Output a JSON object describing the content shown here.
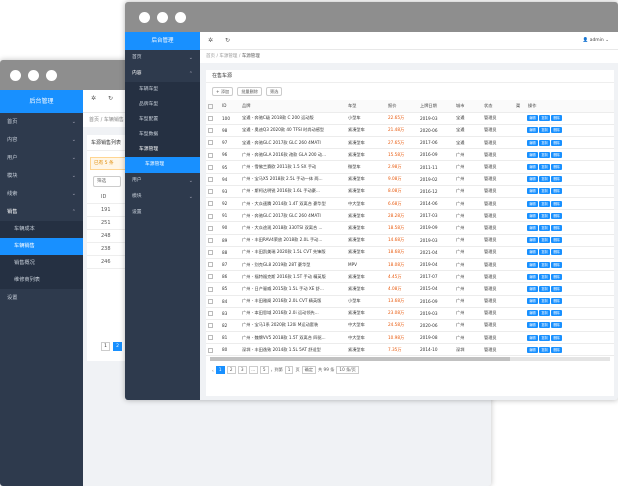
{
  "back": {
    "logo": "后台管理",
    "menu": [
      {
        "label": "首页",
        "chev": "⌄"
      },
      {
        "label": "内容",
        "chev": "⌄"
      },
      {
        "label": "用户",
        "chev": "⌄"
      },
      {
        "label": "模块",
        "chev": "⌄"
      },
      {
        "label": "线索",
        "chev": "⌄"
      },
      {
        "label": "销售",
        "chev": "⌃"
      }
    ],
    "submenu": [
      "车辆成本",
      "车辆销售",
      "销售概况",
      "维修商列表"
    ],
    "settings": "设置",
    "crumb": "首页  /  车辆销售",
    "panel_title": "车源销售列表",
    "warn": "已有 5 条",
    "filter_btn": "筛选",
    "id_header": "ID",
    "ids": [
      "191",
      "251",
      "248",
      "238",
      "246"
    ],
    "pages": [
      "1",
      "2"
    ]
  },
  "front": {
    "logo": "后台管理",
    "menu_top": [
      {
        "label": "首页",
        "chev": "⌄"
      },
      {
        "label": "内容",
        "chev": "⌃"
      }
    ],
    "submenu": [
      "车辆车型",
      "品牌车型",
      "车型配置",
      "车型数据",
      "车源管理"
    ],
    "active_sub": "车源管理",
    "menu_bottom": [
      {
        "label": "用户",
        "chev": "⌄"
      },
      {
        "label": "模块",
        "chev": "⌄"
      },
      {
        "label": "设置",
        "chev": ""
      }
    ],
    "user": "admin",
    "crumb": {
      "home": "首页",
      "sep": "/",
      "mid": "车源管理",
      "cur": "车源管理"
    },
    "card_title": "在售车源",
    "toolbar": [
      "+ 添加",
      "批量删除",
      "筛选"
    ],
    "columns": [
      "",
      "ID",
      "品牌",
      "车型",
      "报价",
      "上牌日期",
      "城市",
      "状态",
      "渠",
      "操作"
    ],
    "rows": [
      [
        "100",
        "宝通 - 奔驰C级 2018款 C 200 运动版",
        "小型车",
        "22.65万",
        "2019-03",
        "宝通",
        "管理员"
      ],
      [
        "98",
        "宝通 - 奥迪Q3 2020款 40 TFSI 时尚动感型",
        "紧凑型车",
        "21.48万",
        "2020-06",
        "宝通",
        "管理员"
      ],
      [
        "97",
        "宝通 - 奔驰GLC 2017款 GLC 260 4MATI",
        "紧凑型车",
        "27.65万",
        "2017-06",
        "宝通",
        "管理员"
      ],
      [
        "96",
        "广州 - 奔驰GLA 2016款 改款 GLA 200 动...",
        "紧凑型车",
        "15.58万",
        "2016-09",
        "广州",
        "管理员"
      ],
      [
        "95",
        "广州 - 雪佛兰赛欧 2011款 1.5 SX 手动",
        "微型车",
        "2.98万",
        "2011-11",
        "广州",
        "管理员"
      ],
      [
        "94",
        "广州 - 宝马X5 2018款 2.5L 手动一体 两...",
        "紧凑型车",
        "9.08万",
        "2019-02",
        "广州",
        "管理员"
      ],
      [
        "93",
        "广州 - 斯柯达明锐 2016款 1.6L 手动豪...",
        "紧凑型车",
        "8.08万",
        "2016-12",
        "广州",
        "管理员"
      ],
      [
        "92",
        "广州 - 大众速腾 2014款 1.4T 双离合 豪华型",
        "中大型车",
        "6.68万",
        "2014-06",
        "广州",
        "管理员"
      ],
      [
        "91",
        "广州 - 奔驰GLC 2017款 GLC 260 4MATI",
        "紧凑型车",
        "28.28万",
        "2017-03",
        "广州",
        "管理员"
      ],
      [
        "90",
        "广州 - 大众途观 2018款 330TSI 双离合 ...",
        "紧凑型车",
        "18.58万",
        "2019-09",
        "广州",
        "管理员"
      ],
      [
        "89",
        "广州 - 丰田RAV4荣放 2018款 2.0L 手动...",
        "紧凑型车",
        "14.68万",
        "2019-03",
        "广州",
        "管理员"
      ],
      [
        "88",
        "广州 - 丰田凯美瑞 2020款 1.5L CVT 先锋版",
        "紧凑型车",
        "18.68万",
        "2021-04",
        "广州",
        "管理员"
      ],
      [
        "87",
        "广州 - 别克GL8 2019款 28T 豪华型",
        "MPV",
        "18.08万",
        "2019-04",
        "广州",
        "管理员"
      ],
      [
        "86",
        "广州 - 福特福克斯 2016款 1.5T 手动 精英版",
        "紧凑型车",
        "4.45万",
        "2017-07",
        "广州",
        "管理员"
      ],
      [
        "85",
        "广州 - 日产骊威 2015款 1.5L 手动 XE 舒...",
        "紧凑型车",
        "4.08万",
        "2015-04",
        "广州",
        "管理员"
      ],
      [
        "84",
        "广州 - 丰田雅阁 2016款 2.0L CVT 精英版",
        "小型车",
        "13.68万",
        "2016-09",
        "广州",
        "管理员"
      ],
      [
        "83",
        "广州 - 本田思域 2016款 2.0i 运动领先...",
        "紧凑型车",
        "23.08万",
        "2019-03",
        "广州",
        "管理员"
      ],
      [
        "82",
        "广州 - 宝马1系 2020款 120i M运动套装",
        "中大型车",
        "24.58万",
        "2020-06",
        "广州",
        "管理员"
      ],
      [
        "81",
        "广州 - 魏牌VV5 2018款 1.5T 双离合 四驱...",
        "中大型车",
        "10.98万",
        "2019-08",
        "广州",
        "管理员"
      ],
      [
        "80",
        "深圳 - 丰田逸致 2014款 1.5L 5AT 舒适型",
        "紧凑型车",
        "7.35万",
        "2014-10",
        "深圳",
        "管理员"
      ]
    ],
    "ops": [
      "编辑",
      "复制",
      "删除"
    ],
    "pager": {
      "prev": "‹",
      "pages": [
        "1",
        "2",
        "3",
        "...",
        "5"
      ],
      "next": "›",
      "goto_label": "到第",
      "goto_val": "1",
      "page_suffix": "页",
      "confirm": "确定",
      "total": "共 99 条",
      "size": "10 条/页"
    }
  }
}
